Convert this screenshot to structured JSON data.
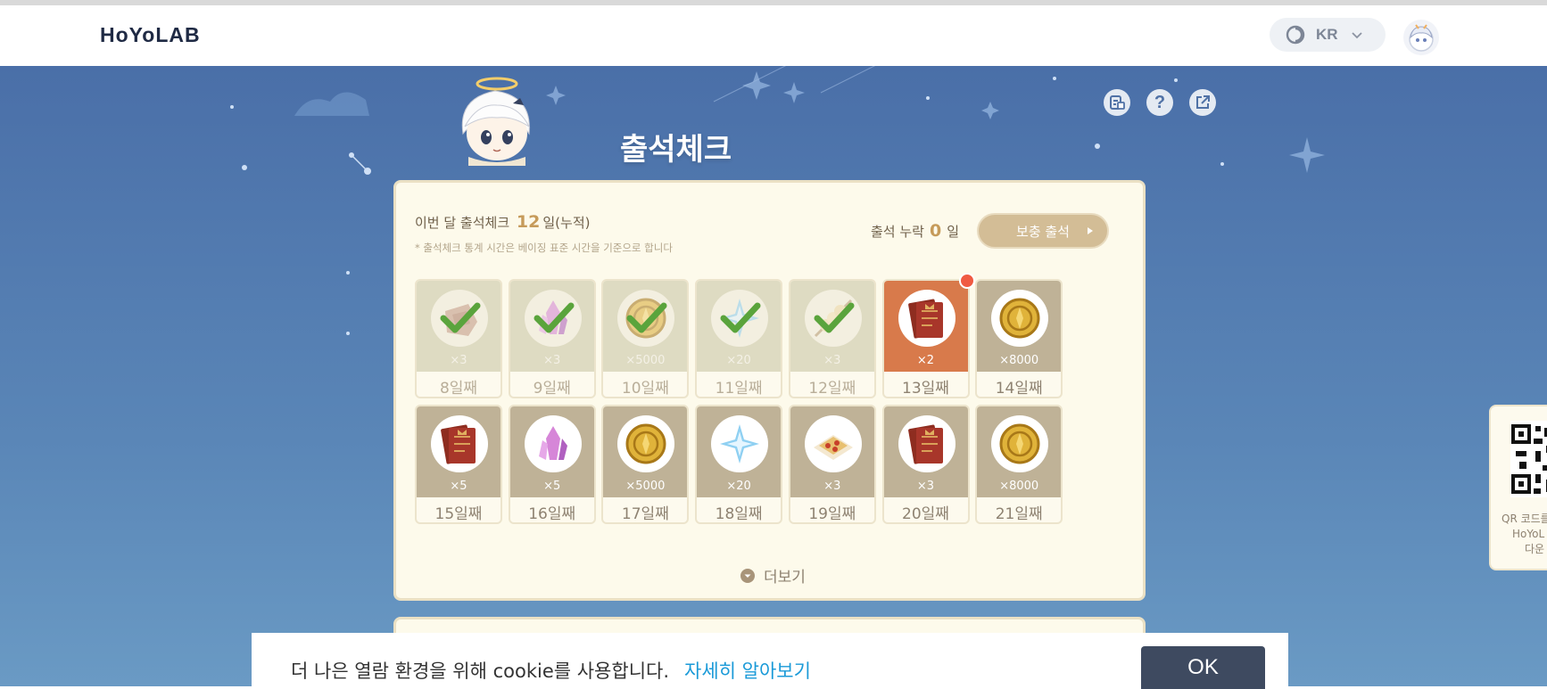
{
  "header": {
    "logo": "HoYoLAB",
    "language": "KR"
  },
  "page": {
    "title": "출석체크"
  },
  "summary": {
    "label_prefix": "이번 달 출석체크",
    "count": "12",
    "label_suffix": "일(누적)",
    "note": "* 출석체크 통계 시간은 베이징 표준 시간을 기준으로 합니다",
    "missed_label": "출석 누락",
    "missed_count": "0",
    "missed_unit": "일",
    "makeup_button": "보충 출석"
  },
  "days": [
    {
      "day": "8일째",
      "qty": "×3",
      "icon": "ore-icon",
      "state": "checked"
    },
    {
      "day": "9일째",
      "qty": "×3",
      "icon": "crystal-icon",
      "state": "checked"
    },
    {
      "day": "10일째",
      "qty": "×5000",
      "icon": "mora-icon",
      "state": "checked"
    },
    {
      "day": "11일째",
      "qty": "×20",
      "icon": "primogem-icon",
      "state": "checked"
    },
    {
      "day": "12일째",
      "qty": "×3",
      "icon": "skewer-icon",
      "state": "checked"
    },
    {
      "day": "13일째",
      "qty": "×2",
      "icon": "book-icon",
      "state": "today"
    },
    {
      "day": "14일째",
      "qty": "×8000",
      "icon": "mora-icon",
      "state": "locked"
    },
    {
      "day": "15일째",
      "qty": "×5",
      "icon": "book-icon",
      "state": "locked"
    },
    {
      "day": "16일째",
      "qty": "×5",
      "icon": "crystal-icon",
      "state": "locked"
    },
    {
      "day": "17일째",
      "qty": "×5000",
      "icon": "mora-icon",
      "state": "locked"
    },
    {
      "day": "18일째",
      "qty": "×20",
      "icon": "primogem-icon",
      "state": "locked"
    },
    {
      "day": "19일째",
      "qty": "×3",
      "icon": "pizza-icon",
      "state": "locked"
    },
    {
      "day": "20일째",
      "qty": "×3",
      "icon": "book-icon",
      "state": "locked"
    },
    {
      "day": "21일째",
      "qty": "×8000",
      "icon": "mora-icon",
      "state": "locked"
    }
  ],
  "more": "더보기",
  "qr": {
    "text_lines": [
      "QR 코드를",
      "HoYoL",
      "다운"
    ]
  },
  "cookie": {
    "message": "더 나은 열람 환경을 위해 cookie를 사용합니다.",
    "link": "자세히 알아보기",
    "ok": "OK"
  },
  "colors": {
    "background": "#5a86b7",
    "card": "#fdfaeb",
    "accent": "#c69b5a",
    "today": "#d87a4b",
    "link": "#1a9ad8"
  }
}
